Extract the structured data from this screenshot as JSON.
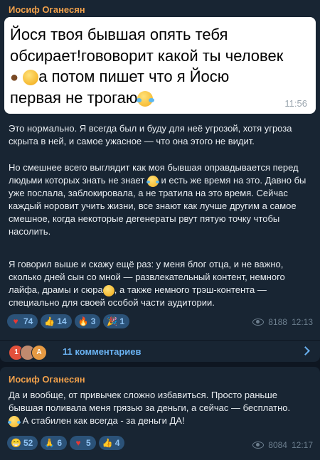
{
  "post1": {
    "author": "Иосиф Оганесян",
    "quote": {
      "line1": "Йося твоя бывшая опять тебя",
      "line2": "обсирает!гововорит какой ты человек",
      "line3": "а потом пишет что я Йосю",
      "line4": "первая не трогаю",
      "time": "11:56"
    },
    "para1": "Это нормально. Я всегда был и буду для неё угрозой, хотя угроза скрыта в ней, и самое ужасное — что она этого не видит.",
    "para2a": "Но смешнее всего выглядит  как моя бывшая оправдывается перед людьми которых знать не знает",
    "para2b": "и есть же время на это. Давно бы уже послала, заблокировала, а не тратила на это время. Сейчас каждый норовит учить жизни, все знают как лучше другим а самое смешное, когда некоторые дегенераты рвут пятую точку чтобы насолить.",
    "para3a": " Я говорил выше и скажу ещё раз: у меня блог отца, и не важно, сколько дней сын со мной — развлекательный контент, немного лайфа, драмы и сюра",
    "para3b": ", а также немного трэш-контента — специально для своей особой части аудитории.",
    "reactions": [
      {
        "icon": "heart-icon",
        "glyph": "♥",
        "color": "#e53935",
        "count": "74"
      },
      {
        "icon": "thumbs-up-icon",
        "glyph": "👍",
        "color": "#f5b830",
        "count": "14"
      },
      {
        "icon": "fire-icon",
        "glyph": "🔥",
        "color": "#ff6d00",
        "count": "3"
      },
      {
        "icon": "party-popper-icon",
        "glyph": "🎉",
        "color": "#f5b830",
        "count": "1"
      }
    ],
    "views": "8188",
    "time": "12:13",
    "comments": {
      "count_badge": "1",
      "avatar2_letter": "",
      "avatar3_letter": "A",
      "label": "11 комментариев"
    }
  },
  "post2": {
    "author": "Иосиф Оганесян",
    "text_a": "Да и вообще, от привычек сложно избавиться. Просто раньше бывшая поливала меня грязью за деньги, а сейчас — бесплатно.",
    "text_b": "А стабилен как всегда - за деньги ДА!",
    "reactions": [
      {
        "icon": "grin-icon",
        "glyph": "😁",
        "color": "#f5b830",
        "count": "52"
      },
      {
        "icon": "praying-hands-icon",
        "glyph": "🙏",
        "color": "#f5b830",
        "count": "6"
      },
      {
        "icon": "heart-icon",
        "glyph": "♥",
        "color": "#e53935",
        "count": "5"
      },
      {
        "icon": "thumbs-up-icon",
        "glyph": "👍",
        "color": "#f5b830",
        "count": "4"
      }
    ],
    "views": "8084",
    "time": "12:17"
  }
}
